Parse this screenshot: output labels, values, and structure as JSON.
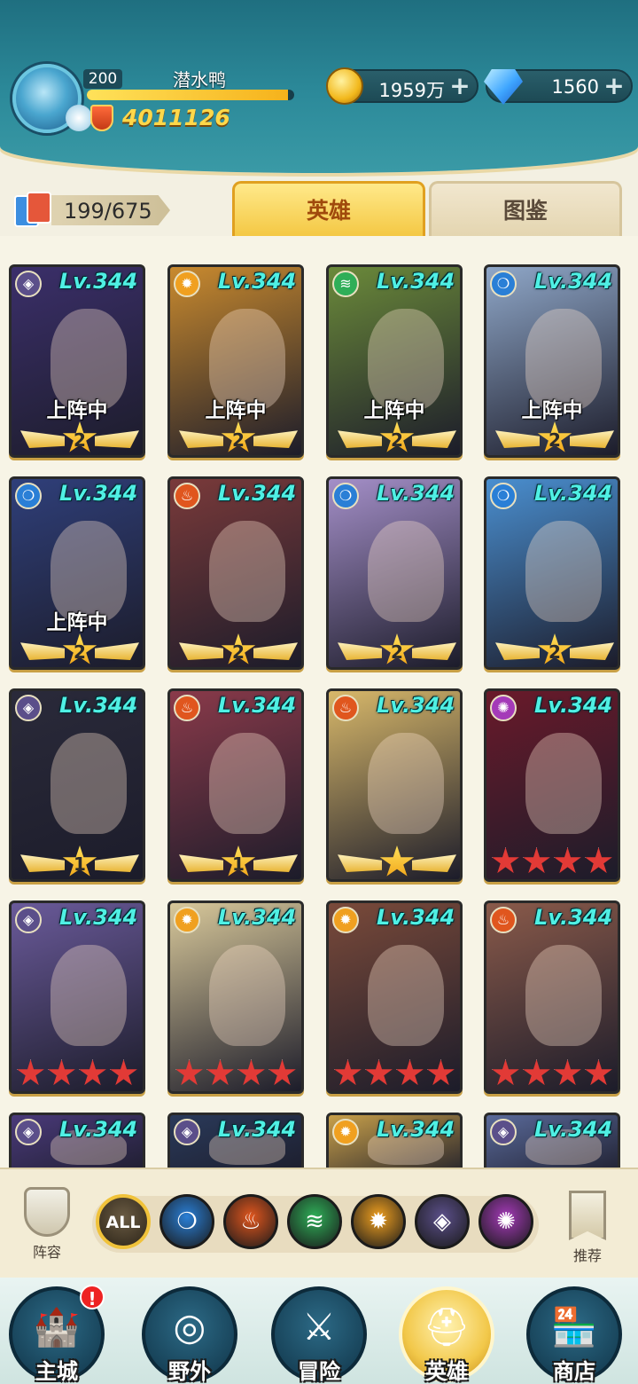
{
  "player": {
    "level": "200",
    "name": "潜水鸭",
    "power": "4011126",
    "xp_fraction": 0.97
  },
  "currencies": {
    "gold": "1959万",
    "gems": "1560"
  },
  "collection": {
    "count": "199/675"
  },
  "tabs": {
    "heroes": "英雄",
    "codex": "图鉴"
  },
  "heroes": [
    {
      "faction": "dark",
      "level": "Lv.344",
      "deployed": "上阵中",
      "stars": "2",
      "rank": "wing"
    },
    {
      "faction": "light",
      "level": "Lv.344",
      "deployed": "上阵中",
      "stars": "2",
      "rank": "wing"
    },
    {
      "faction": "nature",
      "level": "Lv.344",
      "deployed": "上阵中",
      "stars": "2",
      "rank": "wing"
    },
    {
      "faction": "water",
      "level": "Lv.344",
      "deployed": "上阵中",
      "stars": "2",
      "rank": "wing"
    },
    {
      "faction": "water",
      "level": "Lv.344",
      "deployed": "上阵中",
      "stars": "2",
      "rank": "wing"
    },
    {
      "faction": "fire",
      "level": "Lv.344",
      "deployed": "",
      "stars": "2",
      "rank": "wing"
    },
    {
      "faction": "water",
      "level": "Lv.344",
      "deployed": "",
      "stars": "2",
      "rank": "wing"
    },
    {
      "faction": "water",
      "level": "Lv.344",
      "deployed": "",
      "stars": "2",
      "rank": "wing"
    },
    {
      "faction": "dark",
      "level": "Lv.344",
      "deployed": "",
      "stars": "1",
      "rank": "wing"
    },
    {
      "faction": "fire",
      "level": "Lv.344",
      "deployed": "",
      "stars": "1",
      "rank": "wing"
    },
    {
      "faction": "fire",
      "level": "Lv.344",
      "deployed": "",
      "stars": "",
      "rank": "wing"
    },
    {
      "faction": "void",
      "level": "Lv.344",
      "deployed": "",
      "stars": "4",
      "rank": "red"
    },
    {
      "faction": "dark",
      "level": "Lv.344",
      "deployed": "",
      "stars": "4",
      "rank": "red"
    },
    {
      "faction": "light",
      "level": "Lv.344",
      "deployed": "",
      "stars": "4",
      "rank": "red"
    },
    {
      "faction": "light",
      "level": "Lv.344",
      "deployed": "",
      "stars": "4",
      "rank": "red"
    },
    {
      "faction": "fire",
      "level": "Lv.344",
      "deployed": "",
      "stars": "4",
      "rank": "red"
    },
    {
      "faction": "dark",
      "level": "Lv.344",
      "deployed": "",
      "stars": "",
      "rank": "none"
    },
    {
      "faction": "dark",
      "level": "Lv.344",
      "deployed": "",
      "stars": "",
      "rank": "none"
    },
    {
      "faction": "light",
      "level": "Lv.344",
      "deployed": "",
      "stars": "",
      "rank": "none"
    },
    {
      "faction": "dark",
      "level": "Lv.344",
      "deployed": "",
      "stars": "",
      "rank": "none"
    }
  ],
  "faction_colors": {
    "dark": "#5b4f8a",
    "light": "#f0a020",
    "nature": "#2fae58",
    "water": "#2a7fd6",
    "fire": "#e0561e",
    "void": "#a43ab8"
  },
  "faction_icons": {
    "dark": "dark-faction-icon",
    "light": "light-faction-icon",
    "nature": "nature-faction-icon",
    "water": "water-faction-icon",
    "fire": "fire-faction-icon",
    "void": "void-faction-icon"
  },
  "filters": {
    "lineup_label": "阵容",
    "all_label": "ALL",
    "recommend_label": "推荐",
    "factions": [
      "water",
      "fire",
      "nature",
      "light",
      "dark",
      "void"
    ]
  },
  "nav": {
    "main_city": "主城",
    "wild": "野外",
    "adventure": "冒险",
    "heroes": "英雄",
    "shop": "商店",
    "alert": "!"
  }
}
